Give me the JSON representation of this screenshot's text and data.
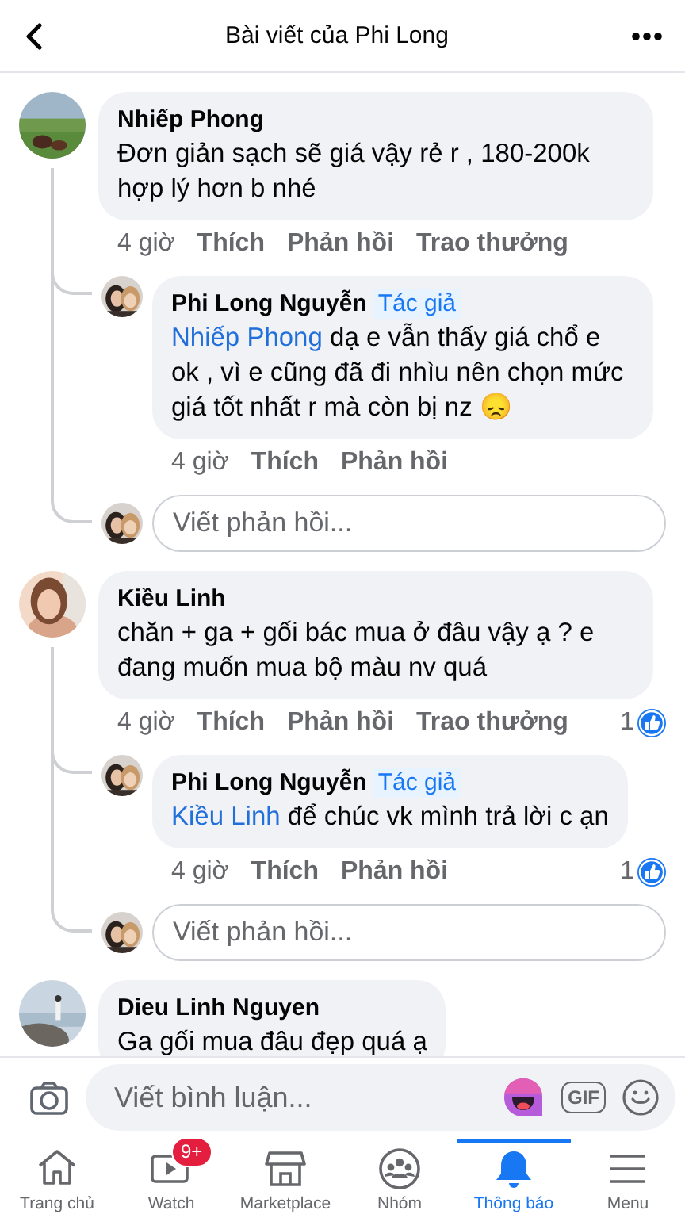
{
  "header": {
    "title": "Bài viết của Phi Long"
  },
  "comments": [
    {
      "name": "Nhiếp Phong",
      "text": "Đơn giản sạch sẽ giá vậy rẻ r , 180-200k hợp lý hơn b nhé",
      "time": "4 giờ",
      "actions": [
        "Thích",
        "Phản hồi",
        "Trao thưởng"
      ],
      "replies": [
        {
          "name": "Phi Long Nguyễn",
          "badge": "Tác giả",
          "mention": "Nhiếp Phong",
          "text": "dạ e vẫn thấy giá chổ e ok , vì e cũng đã đi nhìu nên chọn mức giá tốt nhất r mà còn bị nz 😞",
          "time": "4 giờ",
          "actions": [
            "Thích",
            "Phản hồi"
          ]
        }
      ],
      "reply_placeholder": "Viết phản hồi..."
    },
    {
      "name": "Kiều Linh",
      "text": "chăn + ga + gối bác mua ở đâu vậy ạ ? e đang muốn mua bộ màu nv quá",
      "time": "4 giờ",
      "actions": [
        "Thích",
        "Phản hồi",
        "Trao thưởng"
      ],
      "likes": "1",
      "replies": [
        {
          "name": "Phi Long Nguyễn",
          "badge": "Tác giả",
          "mention": "Kiều Linh",
          "text": "để chúc vk mình trả lời c ạn",
          "time": "4 giờ",
          "actions": [
            "Thích",
            "Phản hồi"
          ],
          "likes": "1"
        }
      ],
      "reply_placeholder": "Viết phản hồi..."
    },
    {
      "name": "Dieu Linh Nguyen",
      "text": "Ga gối mua đâu đẹp quá ạ"
    }
  ],
  "composer": {
    "placeholder": "Viết bình luận...",
    "gif": "GIF"
  },
  "tabs": [
    {
      "kind": "home",
      "label": "Trang chủ",
      "selected": false
    },
    {
      "kind": "watch",
      "label": "Watch",
      "badge": "9+",
      "selected": false
    },
    {
      "kind": "marketplace",
      "label": "Marketplace",
      "selected": false
    },
    {
      "kind": "groups",
      "label": "Nhóm",
      "selected": false
    },
    {
      "kind": "notifications",
      "label": "Thông báo",
      "selected": true
    },
    {
      "kind": "menu",
      "label": "Menu",
      "selected": false
    }
  ]
}
